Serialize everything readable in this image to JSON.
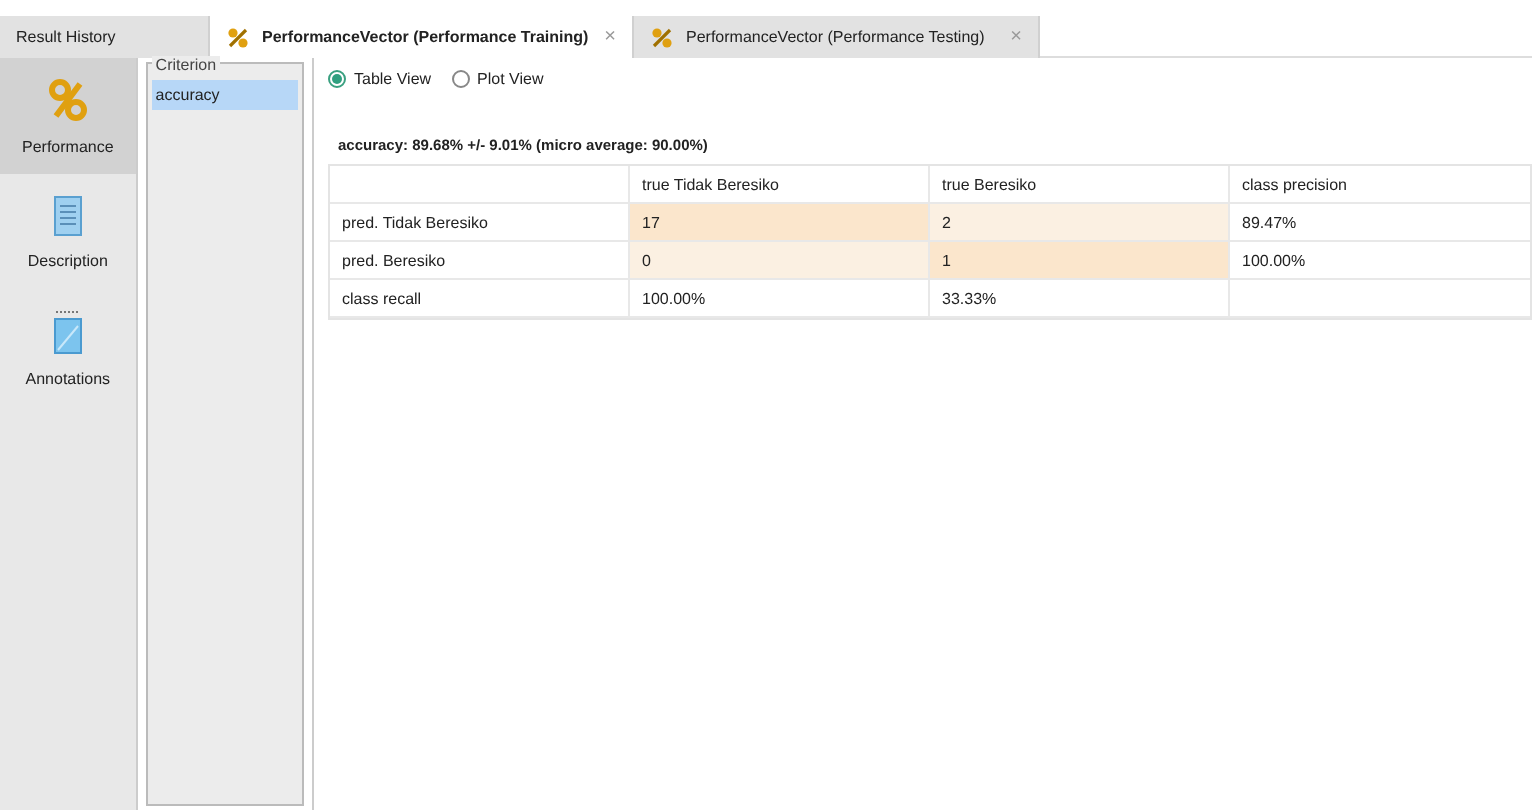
{
  "tabs": [
    {
      "label": "Result History",
      "icon": false,
      "selected": false
    },
    {
      "label": "PerformanceVector (Performance Training)",
      "icon": true,
      "close": "×",
      "selected": true
    },
    {
      "label": "PerformanceVector (Performance Testing)",
      "icon": true,
      "close": "×",
      "selected": false
    }
  ],
  "sidebar": {
    "items": [
      {
        "label": "Performance",
        "kind": "percent",
        "selected": true
      },
      {
        "label": "Description",
        "kind": "document",
        "selected": false
      },
      {
        "label": "Annotations",
        "kind": "note",
        "selected": false
      }
    ]
  },
  "criterion": {
    "title": "Criterion",
    "items": [
      {
        "label": "accuracy",
        "selected": true
      }
    ]
  },
  "view_options": [
    {
      "label": "Table View",
      "selected": true
    },
    {
      "label": "Plot View",
      "selected": false
    }
  ],
  "summary": "accuracy: 89.68% +/- 9.01% (micro average: 90.00%)",
  "table": {
    "columns": [
      "",
      "true Tidak Beresiko",
      "true Beresiko",
      "class precision"
    ],
    "rows": [
      {
        "cells": [
          {
            "text": "pred. Tidak Beresiko"
          },
          {
            "text": "17",
            "color": "#fbe6cc"
          },
          {
            "text": "2",
            "color": "#fbf0e2"
          },
          {
            "text": "89.47%"
          }
        ]
      },
      {
        "cells": [
          {
            "text": "pred. Beresiko"
          },
          {
            "text": "0",
            "color": "#fbf0e2"
          },
          {
            "text": "1",
            "color": "#fbe6cc"
          },
          {
            "text": "100.00%"
          }
        ]
      },
      {
        "cells": [
          {
            "text": "class recall"
          },
          {
            "text": "100.00%"
          },
          {
            "text": "33.33%"
          }
        ]
      }
    ]
  }
}
